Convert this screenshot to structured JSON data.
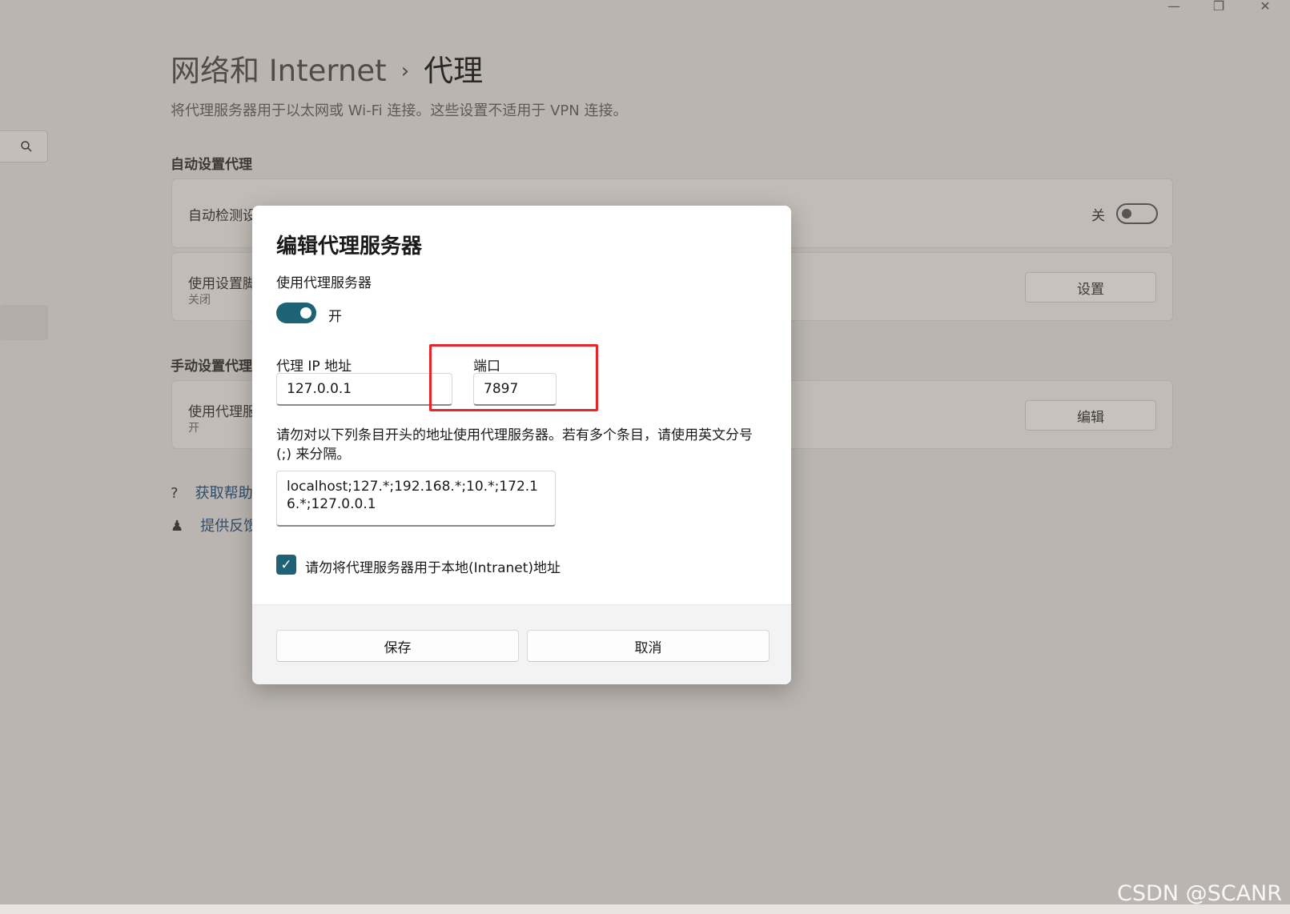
{
  "window_controls": {
    "minimize": "—",
    "restore": "❐",
    "close": "✕"
  },
  "breadcrumb": {
    "parent": "网络和 Internet",
    "separator": "›",
    "current": "代理"
  },
  "description": "将代理服务器用于以太网或 Wi-Fi 连接。这些设置不适用于 VPN 连接。",
  "auto_section": {
    "heading": "自动设置代理",
    "detect_label": "自动检测设",
    "detect_toggle_text": "关",
    "script_label": "使用设置脚",
    "script_sub": "关闭",
    "script_button": "设置"
  },
  "manual_section": {
    "heading": "手动设置代理",
    "proxy_label": "使用代理服",
    "proxy_sub": "开",
    "edit_button": "编辑"
  },
  "links": {
    "help": "获取帮助",
    "feedback": "提供反馈"
  },
  "dialog": {
    "title": "编辑代理服务器",
    "use_proxy_label": "使用代理服务器",
    "toggle_state": "开",
    "ip_label": "代理 IP 地址",
    "ip_value": "127.0.0.1",
    "port_label": "端口",
    "port_value": "7897",
    "exceptions_desc": "请勿对以下列条目开头的地址使用代理服务器。若有多个条目，请使用英文分号 (;) 来分隔。",
    "exceptions_value": "localhost;127.*;192.168.*;10.*;172.16.*;127.0.0.1",
    "bypass_local_label": "请勿将代理服务器用于本地(Intranet)地址",
    "bypass_local_checked": true,
    "save_button": "保存",
    "cancel_button": "取消"
  },
  "highlight_color": "#e8262a",
  "accent_color": "#1d6275",
  "watermark": "CSDN @SCANR"
}
